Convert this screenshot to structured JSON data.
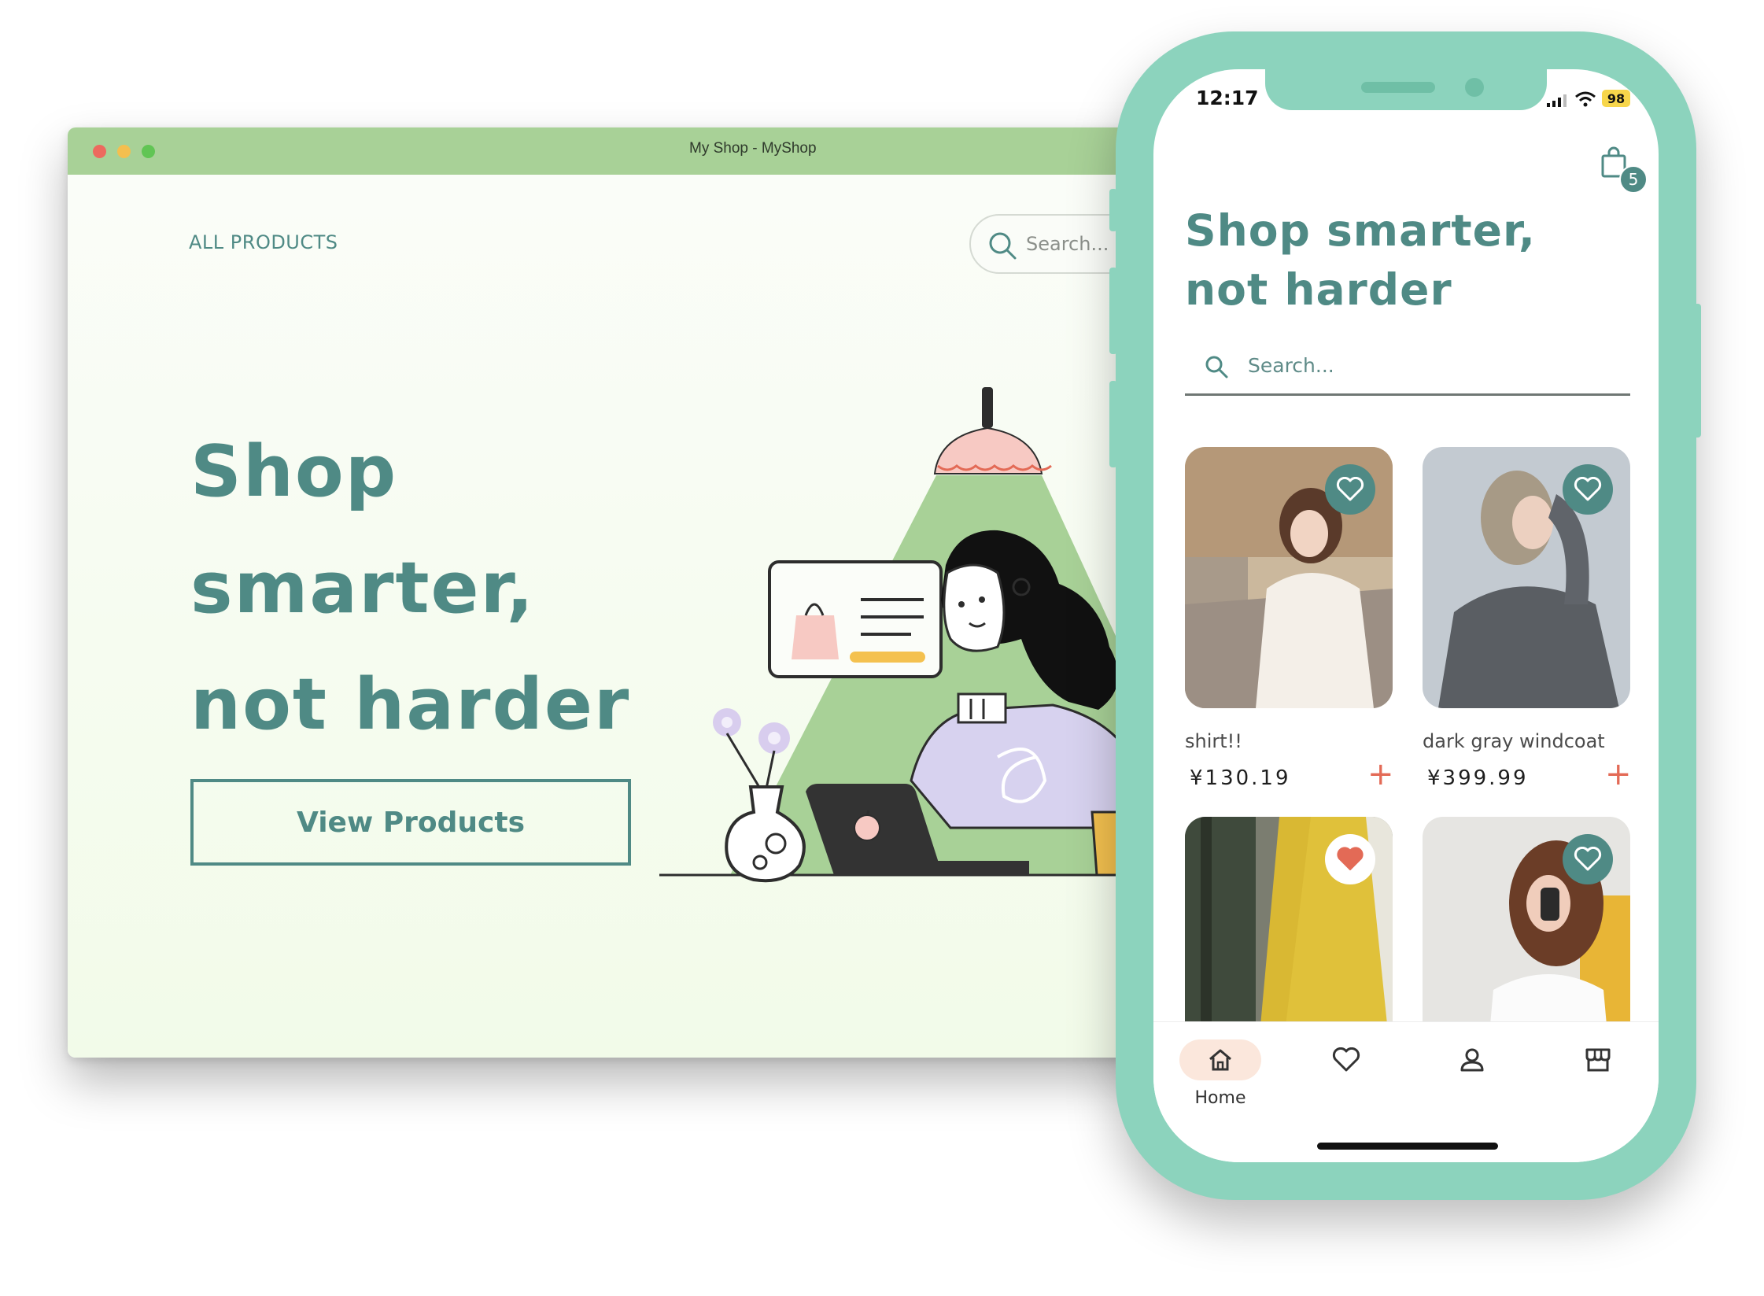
{
  "desktop": {
    "window_title": "My Shop - MyShop",
    "nav_link": "ALL PRODUCTS",
    "search_placeholder": "Search...",
    "hero_title": "Shop smarter, not harder",
    "cta_label": "View Products"
  },
  "phone": {
    "status": {
      "time": "12:17",
      "battery": "98"
    },
    "cart_count": "5",
    "title": "Shop smarter, not harder",
    "search_placeholder": "Search...",
    "products": [
      {
        "name": "shirt!!",
        "price": "¥130.19",
        "favorite": false
      },
      {
        "name": "dark gray windcoat",
        "price": "¥399.99",
        "favorite": false
      },
      {
        "name": "",
        "price": "",
        "favorite": true
      },
      {
        "name": "",
        "price": "",
        "favorite": false
      }
    ],
    "add_symbol": "+",
    "bottom_nav": [
      {
        "label": "Home",
        "icon": "home-icon",
        "active": true
      },
      {
        "label": "",
        "icon": "heart-icon",
        "active": false
      },
      {
        "label": "",
        "icon": "user-icon",
        "active": false
      },
      {
        "label": "",
        "icon": "store-icon",
        "active": false
      }
    ]
  },
  "colors": {
    "brand_teal": "#4f8a85",
    "titlebar_green": "#a8d197",
    "phone_frame": "#8cd3bd",
    "accent_coral": "#e36a56"
  }
}
